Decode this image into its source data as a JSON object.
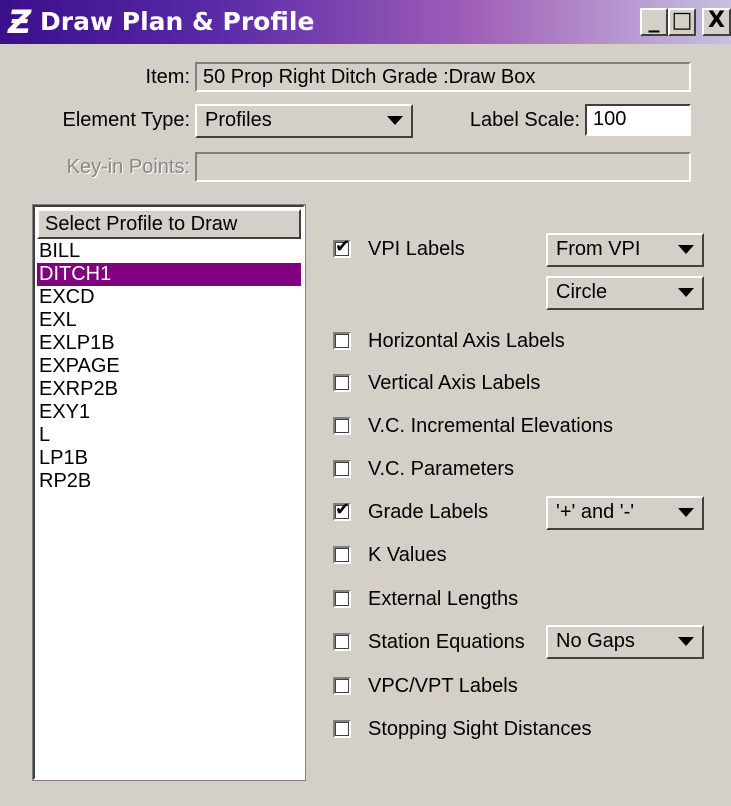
{
  "window": {
    "title": "Draw Plan & Profile",
    "controls": {
      "minimize": "_",
      "maximize": "□",
      "close": "X"
    }
  },
  "form": {
    "item_label": "Item:",
    "item_value": "50 Prop Right Ditch Grade :Draw Box",
    "element_type_label": "Element Type:",
    "element_type_value": "Profiles",
    "label_scale_label": "Label Scale:",
    "label_scale_value": "100",
    "keyin_points_label": "Key-in Points:",
    "keyin_points_value": ""
  },
  "profile_list": {
    "header": "Select Profile to Draw",
    "items": [
      "BILL",
      "DITCH1",
      "EXCD",
      "EXL",
      "EXLP1B",
      "EXPAGE",
      "EXRP2B",
      "EXY1",
      "L",
      "LP1B",
      "RP2B"
    ],
    "selected": "DITCH1"
  },
  "options": [
    {
      "label": "VPI Labels",
      "checked": true,
      "dropdowns": [
        "From VPI",
        "Circle"
      ]
    },
    {
      "label": "Horizontal Axis Labels",
      "checked": false
    },
    {
      "label": "Vertical Axis Labels",
      "checked": false
    },
    {
      "label": "V.C. Incremental Elevations",
      "checked": false
    },
    {
      "label": "V.C. Parameters",
      "checked": false
    },
    {
      "label": "Grade Labels",
      "checked": true,
      "dropdowns": [
        "'+' and '-'"
      ]
    },
    {
      "label": "K Values",
      "checked": false
    },
    {
      "label": "External Lengths",
      "checked": false
    },
    {
      "label": "Station Equations",
      "checked": false,
      "dropdowns": [
        "No Gaps"
      ]
    },
    {
      "label": "VPC/VPT Labels",
      "checked": false
    },
    {
      "label": "Stopping Sight Distances",
      "checked": false
    }
  ]
}
